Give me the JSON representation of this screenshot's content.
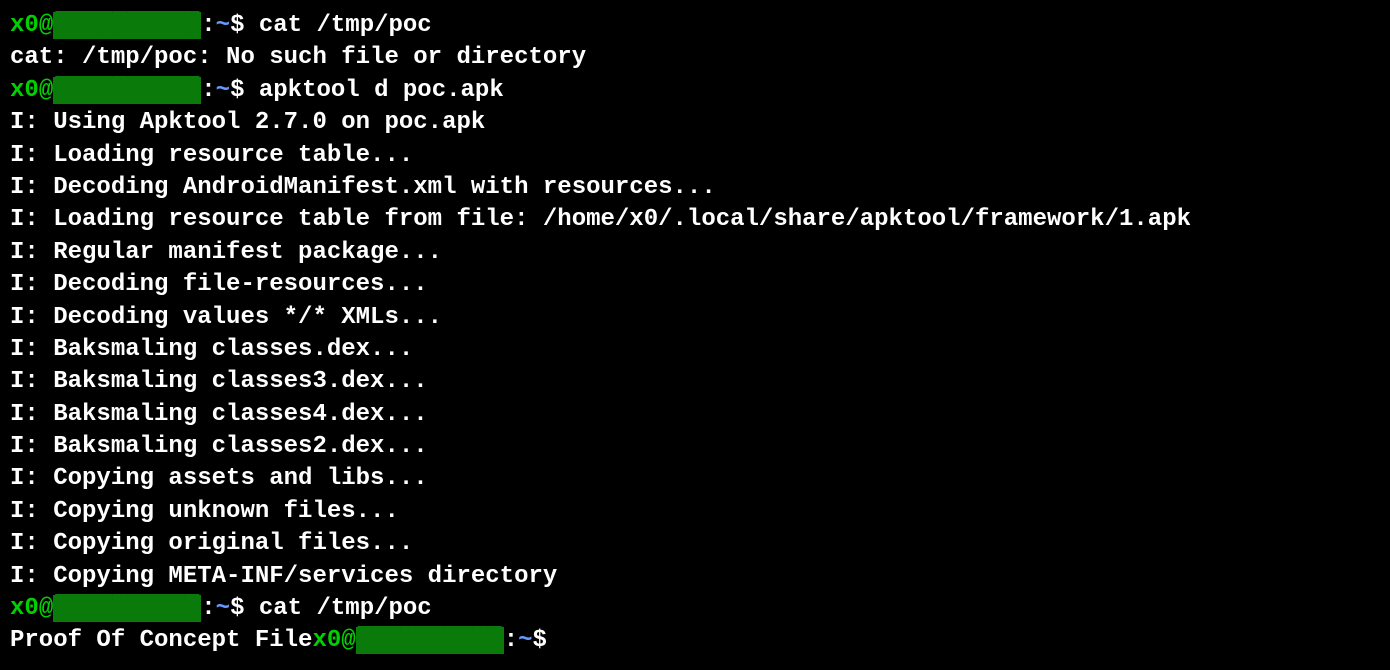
{
  "prompt": {
    "user": "x0",
    "at": "@",
    "host": "██████████",
    "colon": ":",
    "path": "~",
    "dollar": "$ "
  },
  "lines": [
    {
      "type": "prompt",
      "cmd": "cat /tmp/poc"
    },
    {
      "type": "output",
      "text": "cat: /tmp/poc: No such file or directory"
    },
    {
      "type": "prompt",
      "cmd": "apktool d poc.apk"
    },
    {
      "type": "output",
      "text": "I: Using Apktool 2.7.0 on poc.apk"
    },
    {
      "type": "output",
      "text": "I: Loading resource table..."
    },
    {
      "type": "output",
      "text": "I: Decoding AndroidManifest.xml with resources..."
    },
    {
      "type": "output",
      "text": "I: Loading resource table from file: /home/x0/.local/share/apktool/framework/1.apk"
    },
    {
      "type": "output",
      "text": "I: Regular manifest package..."
    },
    {
      "type": "output",
      "text": "I: Decoding file-resources..."
    },
    {
      "type": "output",
      "text": "I: Decoding values */* XMLs..."
    },
    {
      "type": "output",
      "text": "I: Baksmaling classes.dex..."
    },
    {
      "type": "output",
      "text": "I: Baksmaling classes3.dex..."
    },
    {
      "type": "output",
      "text": "I: Baksmaling classes4.dex..."
    },
    {
      "type": "output",
      "text": "I: Baksmaling classes2.dex..."
    },
    {
      "type": "output",
      "text": "I: Copying assets and libs..."
    },
    {
      "type": "output",
      "text": "I: Copying unknown files..."
    },
    {
      "type": "output",
      "text": "I: Copying original files..."
    },
    {
      "type": "output",
      "text": "I: Copying META-INF/services directory"
    },
    {
      "type": "prompt",
      "cmd": "cat /tmp/poc"
    }
  ],
  "lastline": {
    "prefix": "Proof Of Concept File"
  }
}
